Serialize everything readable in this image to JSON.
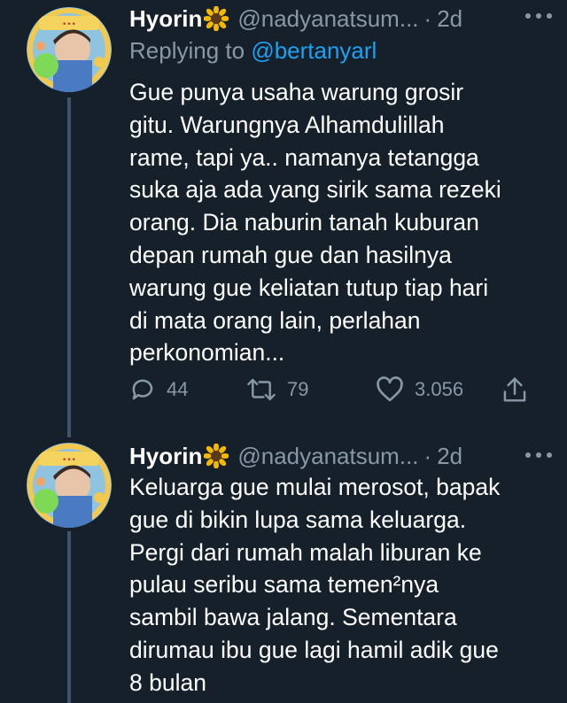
{
  "tweets": [
    {
      "author_name": "Hyorin",
      "author_emoji": "sunflower",
      "handle": "@nadyanatsum...",
      "separator": "·",
      "time": "2d",
      "more_icon": "more-icon",
      "reply_prefix": "Replying to",
      "reply_mention": "@bertanyarl",
      "text_lines": [
        "Gue punya usaha warung grosir",
        "gitu. Warungnya Alhamdulillah",
        "rame, tapi ya.. namanya tetangga",
        "suka aja ada yang sirik sama rezeki",
        "orang. Dia naburin tanah kuburan",
        "depan rumah gue dan hasilnya",
        "warung gue keliatan tutup tiap hari",
        "di mata orang lain, perlahan",
        "perkonomian..."
      ],
      "replies": "44",
      "retweets": "79",
      "likes": "3.056"
    },
    {
      "author_name": "Hyorin",
      "author_emoji": "sunflower",
      "handle": "@nadyanatsum...",
      "separator": "·",
      "time": "2d",
      "more_icon": "more-icon",
      "text_lines": [
        "Keluarga gue mulai merosot, bapak",
        "gue di bikin lupa sama keluarga.",
        "Pergi dari rumah malah liburan ke",
        "pulau seribu sama temen²nya",
        "sambil bawa jalang. Sementara",
        "dirumau ibu gue lagi hamil adik gue",
        "8 bulan"
      ]
    }
  ],
  "colors": {
    "background": "#15202b",
    "secondary_text": "#8899a6",
    "link": "#1da1f2",
    "thread_line": "#3d5466"
  }
}
